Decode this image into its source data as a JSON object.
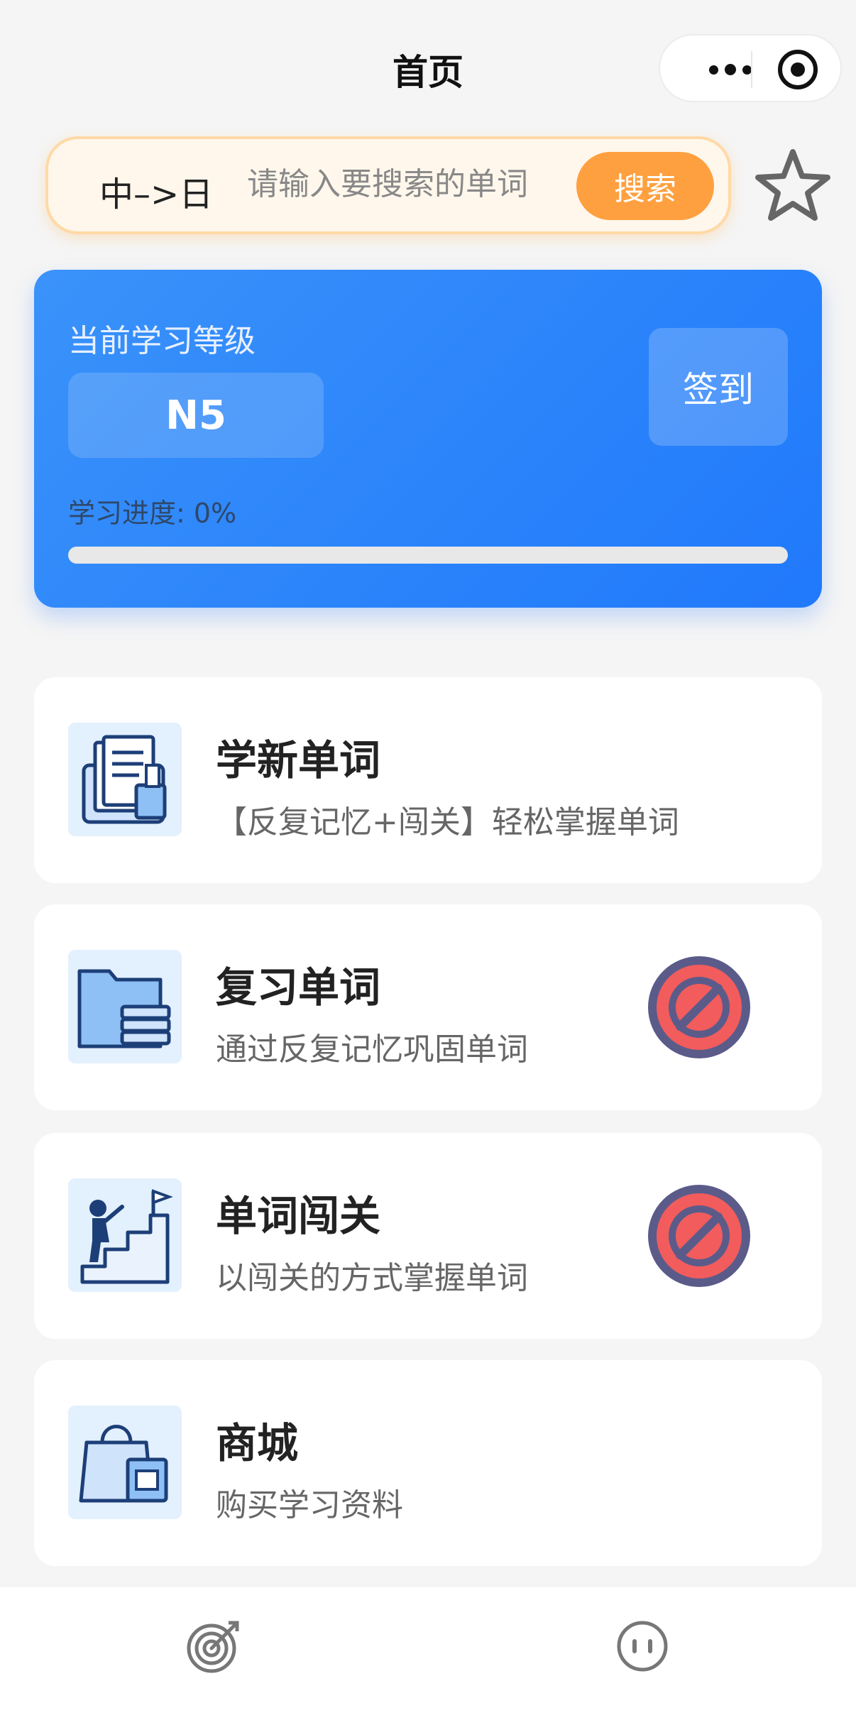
{
  "nav": {
    "title": "首页"
  },
  "search": {
    "mode": "中–>日",
    "placeholder": "请输入要搜索的单词",
    "button_label": "搜索"
  },
  "level_card": {
    "label": "当前学习等级",
    "level": "N5",
    "checkin_label": "签到",
    "progress_text": "学习进度: 0%",
    "progress_value": 0
  },
  "cards": [
    {
      "title": "学新单词",
      "desc": "【反复记忆+闯关】轻松掌握单词",
      "icon": "book-stack-icon",
      "locked": false
    },
    {
      "title": "复习单词",
      "desc": "通过反复记忆巩固单词",
      "icon": "folder-books-icon",
      "locked": true
    },
    {
      "title": "单词闯关",
      "desc": "以闯关的方式掌握单词",
      "icon": "stairs-flag-icon",
      "locked": true
    },
    {
      "title": "商城",
      "desc": "购买学习资料",
      "icon": "shopping-bag-icon",
      "locked": false
    }
  ],
  "tabbar": {
    "items": [
      {
        "icon": "target-icon"
      },
      {
        "icon": "face-icon"
      }
    ]
  },
  "colors": {
    "accent_orange": "#ffa040",
    "card_blue": "#2a84fb",
    "ban_red": "#f25c5c",
    "ban_ring": "#5b5b8a"
  }
}
